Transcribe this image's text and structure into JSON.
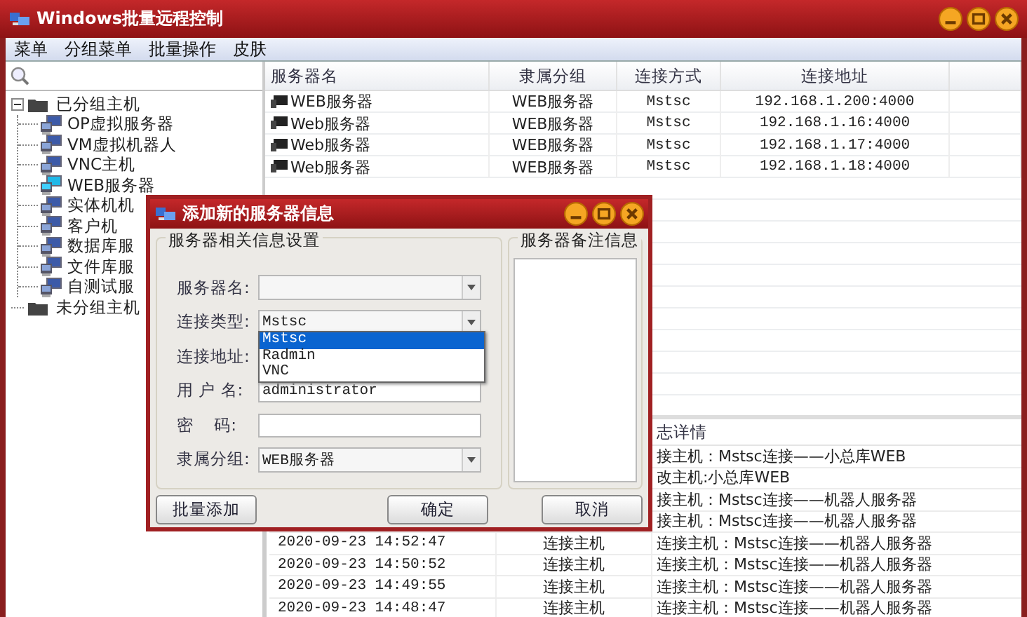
{
  "window": {
    "title": "Windows批量远程控制"
  },
  "menu": [
    "菜单",
    "分组菜单",
    "批量操作",
    "皮肤"
  ],
  "tree": [
    {
      "label": "已分组主机",
      "expanded": true,
      "children": [
        {
          "label": "OP虚拟服务器",
          "selected": false
        },
        {
          "label": "VM虚拟机器人",
          "selected": false
        },
        {
          "label": "VNC主机",
          "selected": false
        },
        {
          "label": "WEB服务器",
          "selected": true
        },
        {
          "label": "实体机机",
          "selected": false
        },
        {
          "label": "客户机",
          "selected": false
        },
        {
          "label": "数据库服",
          "selected": false
        },
        {
          "label": "文件库服",
          "selected": false
        },
        {
          "label": "自测试服",
          "selected": false
        }
      ]
    },
    {
      "label": "未分组主机"
    }
  ],
  "servers": {
    "columns": [
      "服务器名",
      "隶属分组",
      "连接方式",
      "连接地址"
    ],
    "rows": [
      {
        "name": "WEB服务器",
        "group": "WEB服务器",
        "method": "Mstsc",
        "address": "192.168.1.200:4000"
      },
      {
        "name": "Web服务器",
        "group": "WEB服务器",
        "method": "Mstsc",
        "address": "192.168.1.16:4000"
      },
      {
        "name": "Web服务器",
        "group": "WEB服务器",
        "method": "Mstsc",
        "address": "192.168.1.17:4000"
      },
      {
        "name": "Web服务器",
        "group": "WEB服务器",
        "method": "Mstsc",
        "address": "192.168.1.18:4000"
      }
    ]
  },
  "log": {
    "header": "志详情",
    "rows": [
      {
        "detail": "接主机：Mstsc连接——小总库WEB"
      },
      {
        "detail": "改主机:小总库WEB"
      },
      {
        "detail": "接主机：Mstsc连接——机器人服务器"
      },
      {
        "detail": "接主机：Mstsc连接——机器人服务器"
      },
      {
        "time": "2020-09-23 14:52:47",
        "action": "连接主机",
        "detail": "连接主机：Mstsc连接——机器人服务器"
      },
      {
        "time": "2020-09-23 14:50:52",
        "action": "连接主机",
        "detail": "连接主机：Mstsc连接——机器人服务器"
      },
      {
        "time": "2020-09-23 14:49:55",
        "action": "连接主机",
        "detail": "连接主机：Mstsc连接——机器人服务器"
      },
      {
        "time": "2020-09-23 14:48:47",
        "action": "连接主机",
        "detail": "连接主机：Mstsc连接——机器人服务器"
      }
    ]
  },
  "dialog": {
    "title": "添加新的服务器信息",
    "settings_group": "服务器相关信息设置",
    "notes_group": "服务器备注信息",
    "fields": [
      {
        "label": "服务器名:",
        "kind": "combo"
      },
      {
        "label": "连接类型:",
        "kind": "combo",
        "value": "Mstsc"
      },
      {
        "label": "连接地址:",
        "kind": "hidden"
      },
      {
        "label": "用 户 名:",
        "kind": "text",
        "value": "administrator"
      },
      {
        "label": "密    码:",
        "kind": "text"
      },
      {
        "label": "隶属分组:",
        "kind": "combo",
        "value": "WEB服务器"
      }
    ],
    "dropdown": [
      {
        "label": "Mstsc",
        "selected": true
      },
      {
        "label": "Radmin",
        "selected": false
      },
      {
        "label": "VNC",
        "selected": false
      }
    ],
    "buttons": [
      "批量添加",
      "确定",
      "取消"
    ]
  }
}
